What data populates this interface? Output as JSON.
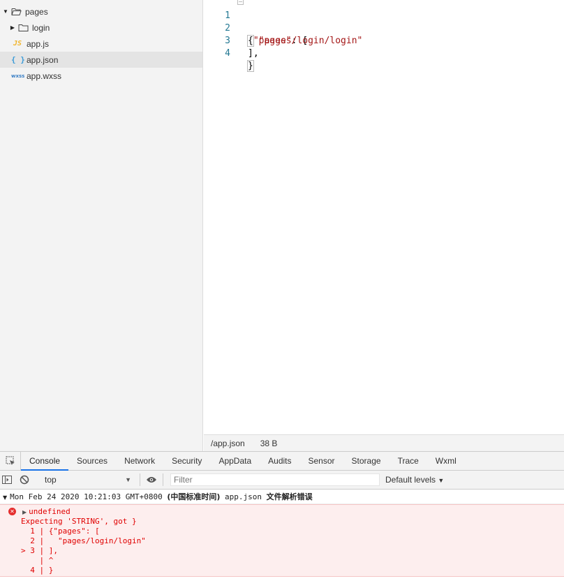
{
  "file_tree": {
    "items": [
      {
        "label": "pages",
        "type": "folder",
        "expanded": true
      },
      {
        "label": "login",
        "type": "folder",
        "expanded": false
      },
      {
        "label": "app.js",
        "icon_text": "JS"
      },
      {
        "label": "app.json",
        "icon_text": "{ }",
        "selected": true
      },
      {
        "label": "app.wxss",
        "icon_text": "wxss"
      }
    ]
  },
  "editor": {
    "lines": [
      {
        "num": "1",
        "p1": "{",
        "s1": "\"pages\"",
        "p2": ": ["
      },
      {
        "num": "2",
        "p1": "  ",
        "s1": "\"pages/login/login\"",
        "p2": ""
      },
      {
        "num": "3",
        "p1": "],",
        "s1": "",
        "p2": ""
      },
      {
        "num": "4",
        "p1": "}",
        "s1": "",
        "p2": ""
      }
    ]
  },
  "status_bar": {
    "path": "/app.json",
    "size": "38 B"
  },
  "devtools": {
    "tabs": [
      "Console",
      "Sources",
      "Network",
      "Security",
      "AppData",
      "Audits",
      "Sensor",
      "Storage",
      "Trace",
      "Wxml"
    ],
    "active_tab": "Console"
  },
  "console_toolbar": {
    "context": "top",
    "filter_placeholder": "Filter",
    "levels": "Default levels"
  },
  "console": {
    "group_header_time": "Mon Feb 24 2020 10:21:03 GMT+0800",
    "group_header_cn": "(中国标准时间)",
    "group_header_file": " app.json ",
    "group_header_msg": "文件解析错误",
    "error_lines": [
      "undefined",
      "Expecting 'STRING', got }",
      "  1 | {\"pages\": [",
      "  2 |   \"pages/login/login\"",
      "> 3 | ],",
      "    | ^",
      "  4 | }"
    ]
  },
  "colors": {
    "error": "#e00000",
    "error_bg": "#fdeeee",
    "active_tab_underline": "#1a73e8",
    "string": "#a31515",
    "line_number": "#237893"
  }
}
